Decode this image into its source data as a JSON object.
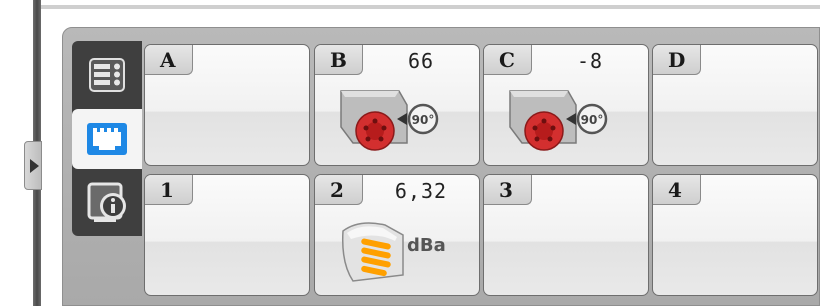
{
  "ports": {
    "A": {
      "id": "A",
      "value": ""
    },
    "B": {
      "id": "B",
      "value": "66",
      "device": "medium-motor-icon"
    },
    "C": {
      "id": "C",
      "value": "-8",
      "device": "medium-motor-icon"
    },
    "D": {
      "id": "D",
      "value": ""
    },
    "1": {
      "id": "1",
      "value": ""
    },
    "2": {
      "id": "2",
      "value": "6,32",
      "device": "sound-sensor-icon",
      "unit": "dBa"
    },
    "3": {
      "id": "3",
      "value": ""
    },
    "4": {
      "id": "4",
      "value": ""
    }
  },
  "motor_label": "90°",
  "sidebar": {
    "tabs": [
      "list-view-icon",
      "port-view-icon",
      "brick-info-icon"
    ],
    "active": "port-view-icon"
  },
  "colors": {
    "accent": "#1e88e5",
    "motor_red": "#d32f2f",
    "panel": "#b3b3b3",
    "sidebar_dark": "#3f3f3f"
  }
}
